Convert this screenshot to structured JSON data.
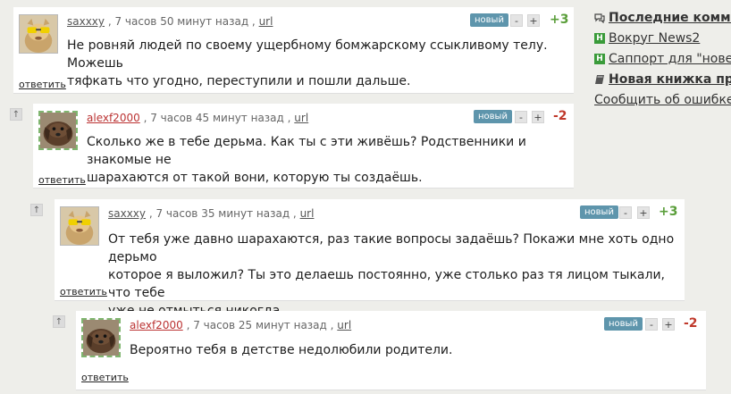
{
  "comments": [
    {
      "username": "saxxxy",
      "time": ", 7 часов 50 минут назад ,",
      "url": "url",
      "badge": "новый",
      "minus": "-",
      "plus": "+",
      "score": "+3",
      "lines": [
        "Не ровняй людей по своему ущербному бомжарскому ссыкливому телу. Можешь",
        "тяфкать что угодно, переступили и пошли дальше."
      ],
      "reply": "ответить"
    },
    {
      "username": "alexf2000",
      "time": ", 7 часов 45 минут назад ,",
      "url": "url",
      "badge": "новый",
      "minus": "-",
      "plus": "+",
      "score": "-2",
      "lines": [
        "Сколько же в тебе дерьма. Как ты с эти живёшь? Родственники и знакомые не",
        "шарахаются от такой вони, которую ты создаёшь."
      ],
      "reply": "ответить",
      "up": "↑"
    },
    {
      "username": "saxxxy",
      "time": ", 7 часов 35 минут назад ,",
      "url": "url",
      "badge": "новый",
      "minus": "-",
      "plus": "+",
      "score": "+3",
      "lines": [
        "От тебя уже давно шарахаются, раз такие вопросы задаёшь? Покажи мне хоть одно дерьмо",
        "которое я выложил? Ты это делаешь постоянно, уже столько раз тя лицом тыкали, что тебе",
        "уже не отмыться никогда."
      ],
      "reply": "ответить",
      "up": "↑"
    },
    {
      "username": "alexf2000",
      "time": ", 7 часов 25 минут назад ,",
      "url": "url",
      "badge": "новый",
      "minus": "-",
      "plus": "+",
      "score": "-2",
      "lines": [
        "Вероятно тебя в детстве недолюбили родители."
      ],
      "reply": "ответить",
      "up": "↑"
    }
  ],
  "sidebar": {
    "items": [
      {
        "label": "Последние комментарии",
        "icon": "comments-icon"
      },
      {
        "label": "Вокруг News2",
        "icon": "green-h-icon"
      },
      {
        "label": "Саппорт для \"новеньких\"",
        "icon": "green-h-icon"
      },
      {
        "label": "Новая книжка предложений",
        "icon": "book-icon"
      },
      {
        "label": "Сообщить об ошибке"
      }
    ]
  },
  "colors": {
    "page_bg": "#eeeeea",
    "badge_blue": "#5e95ac",
    "score_positive": "#5a9e3a",
    "score_negative": "#c0392b",
    "sidebar_green": "#3a9b3a"
  }
}
